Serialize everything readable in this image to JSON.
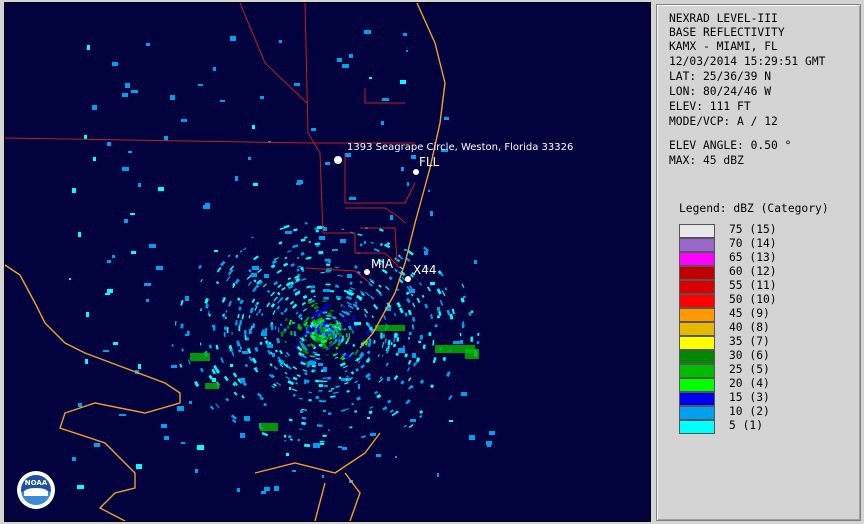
{
  "panel": {
    "lines": [
      "NEXRAD LEVEL-III",
      "BASE REFLECTIVITY",
      "KAMX - MIAMI, FL",
      "12/03/2014 15:29:51 GMT",
      "LAT: 25/36/39 N",
      "LON: 80/24/46 W",
      "ELEV: 111 FT",
      "MODE/VCP: A / 12"
    ],
    "elev_angle": "ELEV ANGLE: 0.50 °",
    "max": "MAX: 45 dBZ",
    "legend_title": "Legend: dBZ (Category)",
    "legend": [
      {
        "label": "75  (15)",
        "color": "#e8e8e8"
      },
      {
        "label": "70  (14)",
        "color": "#9966cc"
      },
      {
        "label": "65  (13)",
        "color": "#ff00ff"
      },
      {
        "label": "60  (12)",
        "color": "#c00000"
      },
      {
        "label": "55  (11)",
        "color": "#d80000"
      },
      {
        "label": "50  (10)",
        "color": "#ff0000"
      },
      {
        "label": "45  (9)",
        "color": "#ff9900"
      },
      {
        "label": "40  (8)",
        "color": "#e6b800"
      },
      {
        "label": "35  (7)",
        "color": "#ffff00"
      },
      {
        "label": "30  (6)",
        "color": "#008800"
      },
      {
        "label": "25  (5)",
        "color": "#00bb00"
      },
      {
        "label": "20  (4)",
        "color": "#00ff00"
      },
      {
        "label": "15  (3)",
        "color": "#0000ee"
      },
      {
        "label": "10  (2)",
        "color": "#00a0f0"
      },
      {
        "label": "5  (1)",
        "color": "#00ffff"
      }
    ]
  },
  "map": {
    "address": "1393 Seagrape Circle, Weston, Florida 33326",
    "fll": "FLL",
    "mia": "MIA",
    "x44": "X44",
    "logo": "NOAA",
    "coast_color": "#f0a030",
    "county_color": "#c02020",
    "water_color": "#02023f"
  }
}
